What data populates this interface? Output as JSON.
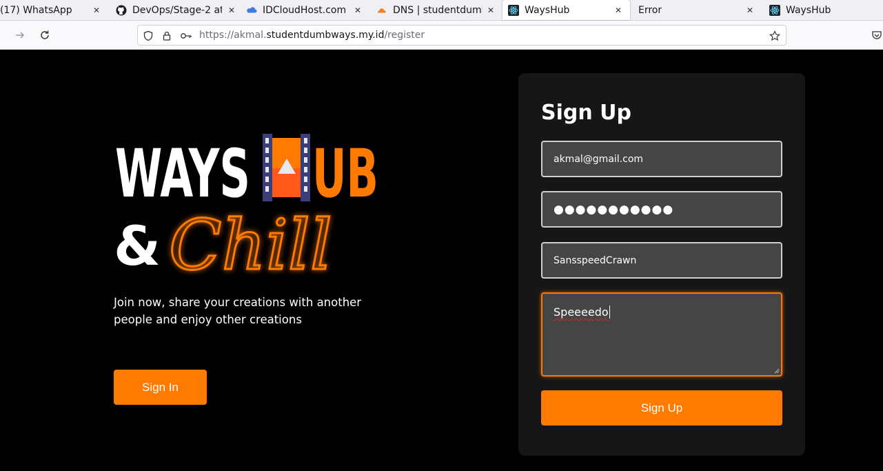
{
  "browser": {
    "tabs": [
      {
        "title": "(17) WhatsApp",
        "icon": "whatsapp-icon"
      },
      {
        "title": "DevOps/Stage-2 at",
        "icon": "github-icon"
      },
      {
        "title": "IDCloudHost.com",
        "icon": "cloud-icon"
      },
      {
        "title": "DNS | studentdumb",
        "icon": "cloudflare-icon"
      },
      {
        "title": "WaysHub",
        "icon": "react-icon"
      },
      {
        "title": "Error",
        "icon": ""
      },
      {
        "title": "WaysHub",
        "icon": "react-icon"
      }
    ],
    "active_tab_index": 4,
    "url": {
      "prefix": "https://akmal.",
      "host": "studentdumbways.my.id",
      "path": "/register"
    }
  },
  "hero": {
    "logo_word_left": "WAYS",
    "logo_word_right": "UB",
    "logo_amp": "&",
    "logo_script": "Chill",
    "tagline": "Join now, share your creations with another people and enjoy other creations",
    "signin_label": "Sign In"
  },
  "form": {
    "title": "Sign Up",
    "email_value": "akmal@gmail.com",
    "password_value": "●●●●●●●●●●●",
    "channel_name_value": "SansspeedCrawn",
    "description_value": "Speeeedo",
    "submit_label": "Sign Up"
  },
  "colors": {
    "accent": "#ff7a00",
    "page_bg": "#000000",
    "card_bg": "#161616",
    "input_bg": "#454545"
  }
}
